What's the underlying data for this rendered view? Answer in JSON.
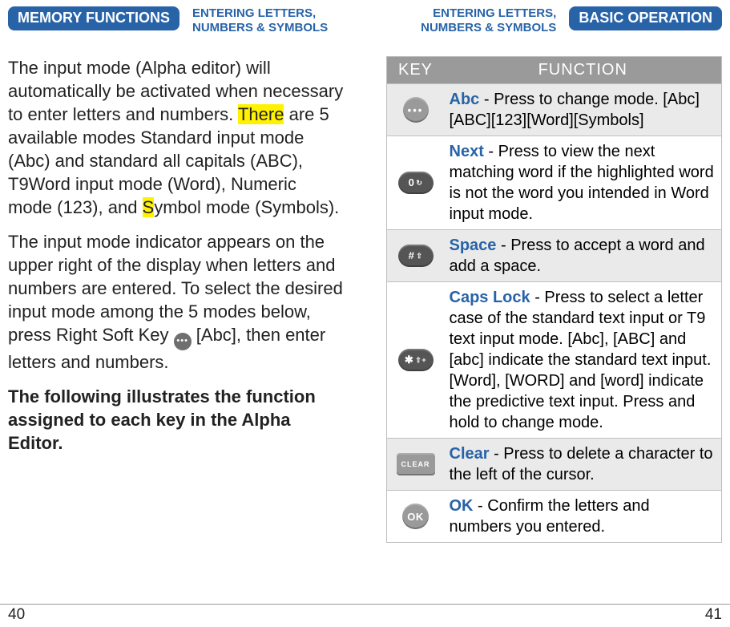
{
  "left": {
    "pill": "MEMORY FUNCTIONS",
    "breadcrumb": "ENTERING LETTERS,\nNUMBERS & SYMBOLS",
    "p1_a": "The input mode (Alpha editor) will automatically be activated when necessary to enter letters and numbers. ",
    "p1_hl1": "There",
    "p1_b": " are 5 available modes Standard input mode (Abc) and standard all capitals (ABC), T9Word input mode (Word), Numeric mode (123), and ",
    "p1_hl2": "S",
    "p1_c": "ymbol mode (Symbols).",
    "p2_a": "The input mode indicator appears on the upper right of the display when letters and numbers are entered. To select the desired input mode among the 5 modes below, press Right Soft Key ",
    "p2_b": " [Abc], then enter letters and numbers.",
    "p3": "The following illustrates the function assigned to each key in the Alpha Editor."
  },
  "right": {
    "breadcrumb": "ENTERING LETTERS,\nNUMBERS & SYMBOLS",
    "pill": "BASIC OPERATION",
    "table": {
      "head_key": "KEY",
      "head_func": "FUNCTION",
      "rows": [
        {
          "keycap": "•••",
          "cls": "round light dots",
          "keyword": "Abc",
          "text": " - Press to change mode. [Abc][ABC][123][Word][Symbols]"
        },
        {
          "keycap": "0",
          "sup": "↻",
          "cls": "pill",
          "keyword": "Next",
          "text": " - Press to view the next matching word if the highlight­ed word is not the word you intended in Word input mode."
        },
        {
          "keycap": "#",
          "sup": "⇧",
          "cls": "pill",
          "keyword": "Space",
          "text": " - Press to accept a word and add a space."
        },
        {
          "keycap": "✱",
          "sup": "⇧+",
          "cls": "pill",
          "keyword": "Caps Lock",
          "text": " - Press to select a letter case of the standard text input or T9 text input mode. [Abc], [ABC] and [abc] indicate the standard text input. [Word], [WORD] and [word] indicate the predictive text input. Press and hold to change mode."
        },
        {
          "keycap": "CLEAR",
          "cls": "clear light",
          "keyword": "Clear",
          "text": " - Press to delete a charac­ter to the left of the cursor."
        },
        {
          "keycap": "OK",
          "cls": "round light",
          "keyword": "OK",
          "text": " - Confirm the letters and numbers you entered."
        }
      ]
    }
  },
  "footer": {
    "left": "40",
    "right": "41"
  }
}
